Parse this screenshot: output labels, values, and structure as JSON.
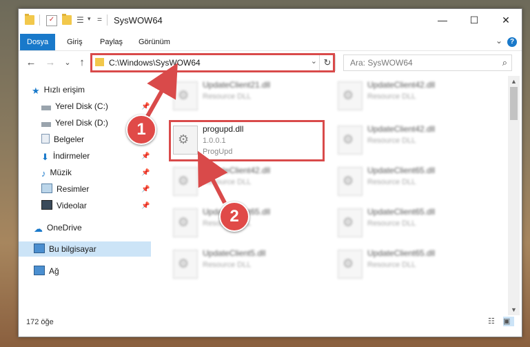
{
  "window": {
    "title": "SysWOW64",
    "minimize_glyph": "—",
    "maximize_glyph": "☐",
    "close_glyph": "✕"
  },
  "ribbon": {
    "tabs": [
      {
        "label": "Dosya",
        "active": true
      },
      {
        "label": "Giriş",
        "active": false
      },
      {
        "label": "Paylaş",
        "active": false
      },
      {
        "label": "Görünüm",
        "active": false
      }
    ],
    "collapse_glyph": "⌄",
    "help_glyph": "?"
  },
  "nav": {
    "back_glyph": "←",
    "forward_glyph": "→",
    "recent_glyph": "⌄",
    "up_glyph": "↑",
    "address": "C:\\Windows\\SysWOW64",
    "refresh_glyph": "↻",
    "dropdown_glyph": "⌄",
    "search_placeholder": "Ara: SysWOW64",
    "search_glyph": "⌕"
  },
  "sidebar": {
    "items": [
      {
        "label": "Hızlı erişim",
        "icon": "star-icon",
        "pinned": false
      },
      {
        "label": "Yerel Disk (C:)",
        "icon": "drive-icon",
        "pinned": true
      },
      {
        "label": "Yerel Disk (D:)",
        "icon": "drive-icon",
        "pinned": true
      },
      {
        "label": "Belgeler",
        "icon": "documents-icon",
        "pinned": true
      },
      {
        "label": "İndirmeler",
        "icon": "download-icon",
        "pinned": true
      },
      {
        "label": "Müzik",
        "icon": "music-icon",
        "pinned": true
      },
      {
        "label": "Resimler",
        "icon": "pictures-icon",
        "pinned": true
      },
      {
        "label": "Videolar",
        "icon": "videos-icon",
        "pinned": true
      },
      {
        "label": "OneDrive",
        "icon": "cloud-icon",
        "pinned": false
      },
      {
        "label": "Bu bilgisayar",
        "icon": "computer-icon",
        "pinned": false,
        "selected": true
      },
      {
        "label": "Ağ",
        "icon": "network-icon",
        "pinned": false
      }
    ],
    "pin_glyph": "📌"
  },
  "files": {
    "left": [
      {
        "name": "UpdateClient21.dll",
        "line1": "Resource DLL",
        "line2": ""
      },
      {
        "name": "progupd.dll",
        "line1": "1.0.0.1",
        "line2": "ProgUpd"
      },
      {
        "name": "UpdateClient42.dll",
        "line1": "Resource DLL",
        "line2": ""
      },
      {
        "name": "UpdateClient65.dll",
        "line1": "Resource DLL",
        "line2": ""
      },
      {
        "name": "UpdateClient5.dll",
        "line1": "Resource DLL",
        "line2": ""
      }
    ],
    "right": [
      {
        "name": "UpdateClient42.dll",
        "line1": "Resource DLL"
      },
      {
        "name": "UpdateClient42.dll",
        "line1": "Resource DLL"
      },
      {
        "name": "UpdateClient65.dll",
        "line1": "Resource DLL"
      },
      {
        "name": "UpdateClient65.dll",
        "line1": "Resource DLL"
      },
      {
        "name": "UpdateClient65.dll",
        "line1": "Resource DLL"
      }
    ]
  },
  "status": {
    "item_count": "172 öğe"
  },
  "annotations": {
    "badge1": "1",
    "badge2": "2",
    "color": "#d94a4a"
  },
  "colors": {
    "accent": "#1979ca",
    "selection": "#cce4f7",
    "highlight": "#d94a4a"
  }
}
